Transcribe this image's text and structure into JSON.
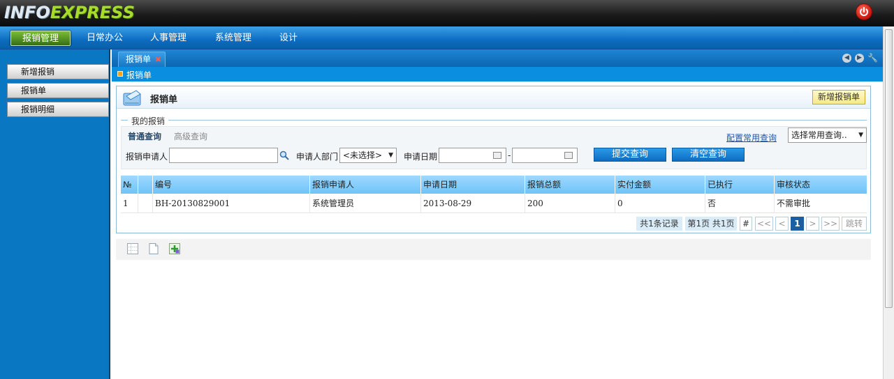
{
  "app": {
    "logo_part1": "INFO",
    "logo_part2": "EXPRESS"
  },
  "menu": {
    "items": [
      {
        "label": "报销管理",
        "active": true
      },
      {
        "label": "日常办公"
      },
      {
        "label": "人事管理"
      },
      {
        "label": "系统管理"
      },
      {
        "label": "设计"
      }
    ]
  },
  "sidebar": {
    "items": [
      {
        "label": "新增报销"
      },
      {
        "label": "报销单"
      },
      {
        "label": "报销明细"
      }
    ]
  },
  "tabs": {
    "active_tab": "报销单",
    "close_glyph": "✖"
  },
  "breadcrumb": {
    "current": "报销单"
  },
  "panel": {
    "title": "报销单",
    "new_button": "新增报销单"
  },
  "query": {
    "legend": "我的报销",
    "tab_normal": "普通查询",
    "tab_advanced": "高级查询",
    "config_link": "配置常用查询",
    "saved_query_placeholder": "选择常用查询..",
    "applicant_label": "报销申请人",
    "applicant_value": "",
    "dept_label": "申请人部门",
    "dept_value": "<未选择>",
    "date_label": "申请日期",
    "date_from": "",
    "date_sep": "-",
    "date_to": "",
    "submit_button": "提交查询",
    "clear_button": "清空查询"
  },
  "grid": {
    "columns": [
      "№",
      "",
      "编号",
      "报销申请人",
      "申请日期",
      "报销总额",
      "实付金额",
      "已执行",
      "审核状态"
    ],
    "rows": [
      {
        "no": "1",
        "mark": "",
        "code": "BH-20130829001",
        "applicant": "系统管理员",
        "date": "2013-08-29",
        "total": "200",
        "paid": "0",
        "executed": "否",
        "status": "不需审批"
      }
    ]
  },
  "pager": {
    "total_records": "共1条记录",
    "page_info": "第1页 共1页",
    "hash": "#",
    "first": "<<",
    "prev": "<",
    "current": "1",
    "next": ">",
    "last": ">>",
    "jump": "跳转"
  },
  "icons": {
    "power": "power-icon",
    "nav_prev": "circle-left-icon",
    "nav_next": "circle-right-icon",
    "wrench": "wrench-icon",
    "search": "magnifier-icon",
    "calendar": "calendar-icon",
    "tool1": "grid-icon",
    "tool2": "page-icon",
    "tool3": "add-column-icon"
  },
  "colors": {
    "menu_active": "#356e14",
    "primary_blue": "#0b65b2",
    "grid_header": "#6ec4f8",
    "new_button_bg": "#f7e98a"
  }
}
